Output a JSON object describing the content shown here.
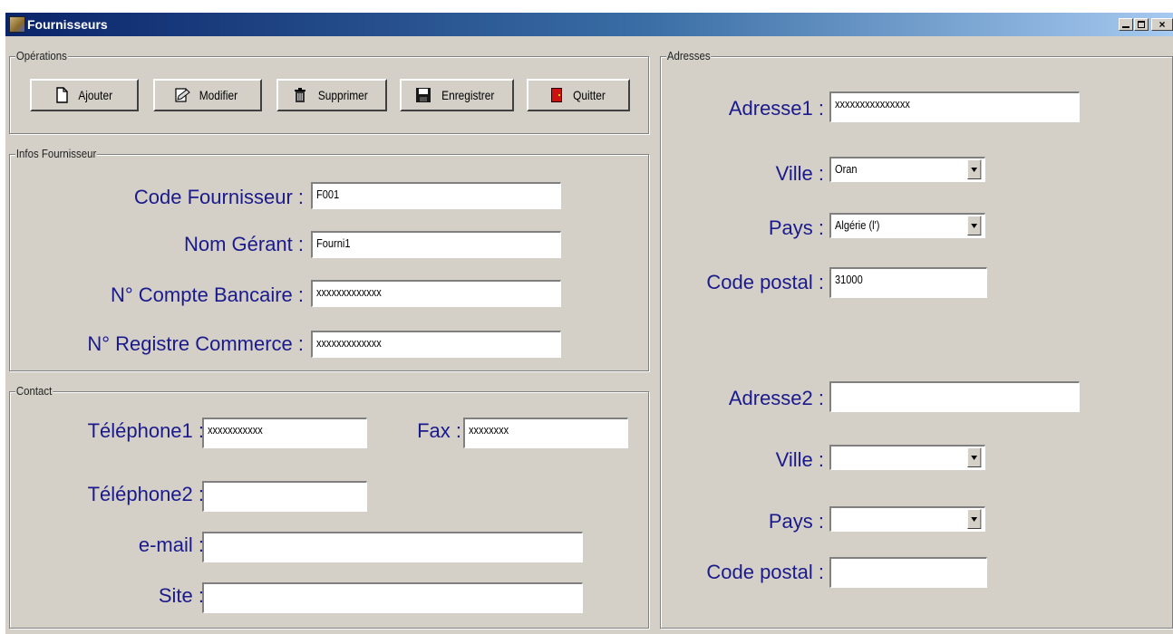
{
  "window": {
    "title": "Fournisseurs"
  },
  "operations": {
    "legend": "Opérations",
    "buttons": {
      "ajouter": "Ajouter",
      "modifier": "Modifier",
      "supprimer": "Supprimer",
      "enregistrer": "Enregistrer",
      "quitter": "Quitter"
    }
  },
  "infos": {
    "legend": "Infos Fournisseur",
    "code_label": "Code Fournisseur :",
    "code_value": "F001",
    "nom_label": "Nom Gérant :",
    "nom_value": "Fourni1",
    "compte_label": "N° Compte Bancaire :",
    "compte_value": "xxxxxxxxxxxxx",
    "registre_label": "N° Registre Commerce :",
    "registre_value": "xxxxxxxxxxxxx"
  },
  "contact": {
    "legend": "Contact",
    "tel1_label": "Téléphone1 :",
    "tel1_value": "xxxxxxxxxxx",
    "fax_label": "Fax :",
    "fax_value": "xxxxxxxx",
    "tel2_label": "Téléphone2 :",
    "tel2_value": "",
    "email_label": "e-mail :",
    "email_value": "",
    "site_label": "Site :",
    "site_value": ""
  },
  "adresses": {
    "legend": "Adresses",
    "adresse1_label": "Adresse1 :",
    "adresse1_value": "xxxxxxxxxxxxxxx",
    "ville1_label": "Ville :",
    "ville1_value": "Oran",
    "pays1_label": "Pays :",
    "pays1_value": "Algérie (l')",
    "cp1_label": "Code postal :",
    "cp1_value": "31000",
    "adresse2_label": "Adresse2 :",
    "adresse2_value": "",
    "ville2_label": "Ville :",
    "ville2_value": "",
    "pays2_label": "Pays :",
    "pays2_value": "",
    "cp2_label": "Code postal :",
    "cp2_value": ""
  }
}
